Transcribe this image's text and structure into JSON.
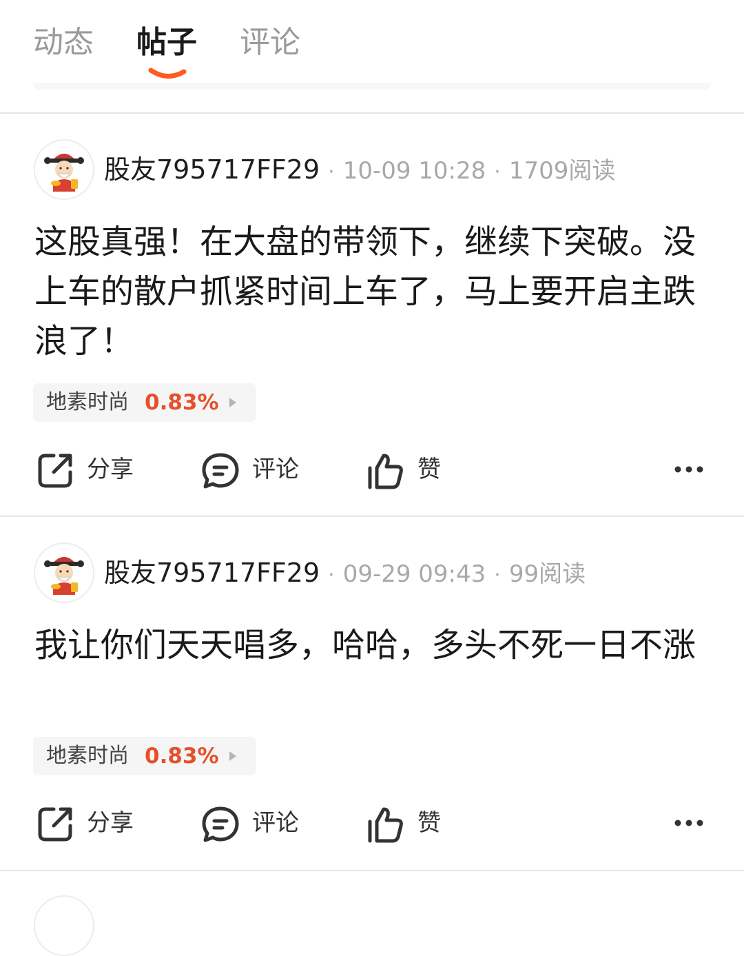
{
  "tabs": [
    {
      "label": "动态",
      "active": false
    },
    {
      "label": "帖子",
      "active": true
    },
    {
      "label": "评论",
      "active": false
    }
  ],
  "accent_color": "#ff5a1f",
  "actions": {
    "share_label": "分享",
    "comment_label": "评论",
    "like_label": "赞"
  },
  "posts": [
    {
      "author": "股友795717FF29",
      "time": "10-09 10:28",
      "reads": "1709阅读",
      "content": "这股真强！在大盘的带领下，继续下突破。没上车的散户抓紧时间上车了，马上要开启主跌浪了！",
      "stock": {
        "name": "地素时尚",
        "change": "0.83%"
      }
    },
    {
      "author": "股友795717FF29",
      "time": "09-29 09:43",
      "reads": "99阅读",
      "content": "我让你们天天唱多，哈哈，多头不死一日不涨",
      "stock": {
        "name": "地素时尚",
        "change": "0.83%"
      }
    }
  ],
  "icons": [
    "share-icon",
    "comment-icon",
    "like-icon",
    "more-icon",
    "avatar-icon",
    "chevron-right-icon"
  ]
}
